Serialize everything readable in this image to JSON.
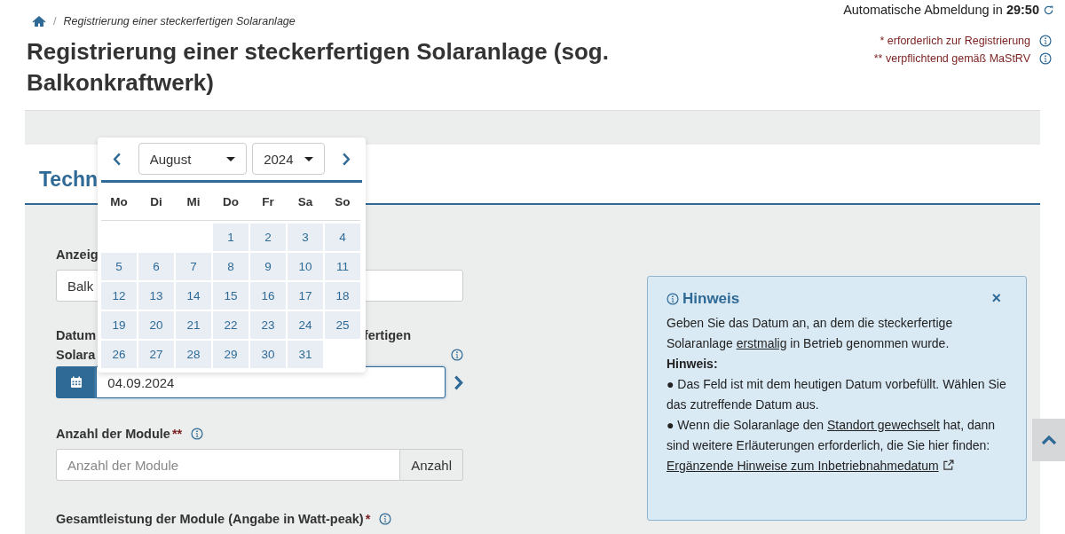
{
  "session": {
    "text": "Automatische Abmeldung in **29:50**"
  },
  "breadcrumb": {
    "separator": "/",
    "items": [
      "Registrierung einer steckerfertigen Solaranlage"
    ]
  },
  "legend": [
    {
      "text": "* erforderlich zur Registrierung"
    },
    {
      "text": "** verpflichtend gemäß MaStRV"
    }
  ],
  "title": "Registrierung einer steckerfertigen Solaranlage (sog. Balkonkraftwerk)",
  "section": {
    "heading": "Techn"
  },
  "fields": [
    {
      "kind": "text",
      "label": "Anzeig",
      "value": "Balk"
    },
    {
      "kind": "date",
      "label_left": "Datum",
      "label_right": "fertigen",
      "label_second": "Solara",
      "value": "04.09.2024"
    },
    {
      "kind": "addon",
      "label": "Anzahl der Module",
      "required": "**",
      "placeholder": "Anzahl der Module",
      "addon": "Anzahl"
    },
    {
      "kind": "label",
      "label": "Gesamtleistung der Module (Angabe in Watt-peak)",
      "required": "*"
    }
  ],
  "datepicker": {
    "month": "August",
    "year": "2024",
    "weekdays": [
      "Mo",
      "Di",
      "Mi",
      "Do",
      "Fr",
      "Sa",
      "So"
    ],
    "days": [
      {
        "kind": "blank"
      },
      {
        "kind": "blank"
      },
      {
        "kind": "blank"
      },
      {
        "kind": "day",
        "day": "1"
      },
      {
        "kind": "day",
        "day": "2"
      },
      {
        "kind": "day",
        "day": "3"
      },
      {
        "kind": "day",
        "day": "4"
      },
      {
        "kind": "day",
        "day": "5"
      },
      {
        "kind": "day",
        "day": "6"
      },
      {
        "kind": "day",
        "day": "7"
      },
      {
        "kind": "day",
        "day": "8"
      },
      {
        "kind": "day",
        "day": "9"
      },
      {
        "kind": "day",
        "day": "10"
      },
      {
        "kind": "day",
        "day": "11"
      },
      {
        "kind": "day",
        "day": "12"
      },
      {
        "kind": "day",
        "day": "13"
      },
      {
        "kind": "day",
        "day": "14"
      },
      {
        "kind": "day",
        "day": "15"
      },
      {
        "kind": "day",
        "day": "16"
      },
      {
        "kind": "day",
        "day": "17"
      },
      {
        "kind": "day",
        "day": "18"
      },
      {
        "kind": "day",
        "day": "19"
      },
      {
        "kind": "day",
        "day": "20"
      },
      {
        "kind": "day",
        "day": "21"
      },
      {
        "kind": "day",
        "day": "22"
      },
      {
        "kind": "day",
        "day": "23"
      },
      {
        "kind": "day",
        "day": "24"
      },
      {
        "kind": "day",
        "day": "25"
      },
      {
        "kind": "day",
        "day": "26"
      },
      {
        "kind": "day",
        "day": "27"
      },
      {
        "kind": "day",
        "day": "28"
      },
      {
        "kind": "day",
        "day": "29"
      },
      {
        "kind": "day",
        "day": "30"
      },
      {
        "kind": "day",
        "day": "31"
      }
    ]
  },
  "hint": {
    "title": "Hinweis",
    "close": "×",
    "paragraphs": [
      {
        "kind": "text",
        "parts": [
          {
            "text": "Geben Sie das Datum an, an dem die steckerfertige Solaranlage "
          },
          {
            "link": "erstmalig"
          },
          {
            "text": " in Betrieb genommen wurde."
          }
        ]
      },
      {
        "kind": "heading",
        "parts": [
          {
            "text": "Hinweis:"
          }
        ]
      },
      {
        "kind": "bullet",
        "bullet": "●",
        "parts": [
          {
            "text": "Das Feld ist mit dem heutigen Datum vorbefüllt. Wählen Sie das zutreffende Datum aus."
          }
        ]
      },
      {
        "kind": "bullet",
        "bullet": "●",
        "parts": [
          {
            "text": "Wenn die Solaranlage den "
          },
          {
            "link": "Standort gewechselt"
          },
          {
            "text": " hat, dann sind weitere Erläuterungen erforderlich, die Sie hier finden: "
          },
          {
            "link": "Ergänzende Hinweise zum Inbetriebnahmedatum",
            "external": true
          }
        ]
      }
    ]
  }
}
